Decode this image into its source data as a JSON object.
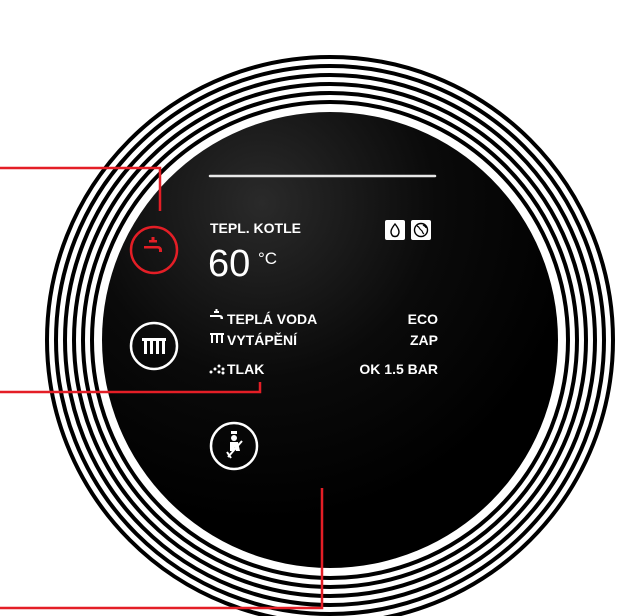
{
  "display": {
    "title": "TEPL. KOTLE",
    "temperature_value": "60",
    "temperature_unit": "°C",
    "status_icons": [
      "flame-icon",
      "globe-icon"
    ]
  },
  "status": [
    {
      "icon": "tap-icon",
      "label": "TEPLÁ VODA",
      "value": "ECO"
    },
    {
      "icon": "radiator-icon",
      "label": "VYTÁPĚNÍ",
      "value": "ZAP"
    },
    {
      "icon": "pressure-icon",
      "label": "TLAK",
      "value": "OK 1.5 BAR"
    }
  ],
  "buttons": [
    {
      "name": "hot-water-button",
      "icon": "tap-icon",
      "state": "active"
    },
    {
      "name": "heating-button",
      "icon": "radiator-icon",
      "state": "idle"
    },
    {
      "name": "chimney-sweep-button",
      "icon": "chimney-sweep-icon",
      "state": "idle"
    }
  ],
  "colors": {
    "accent": "#e41e26",
    "panel": "#000000",
    "ring": "#000000",
    "text": "#ffffff"
  }
}
